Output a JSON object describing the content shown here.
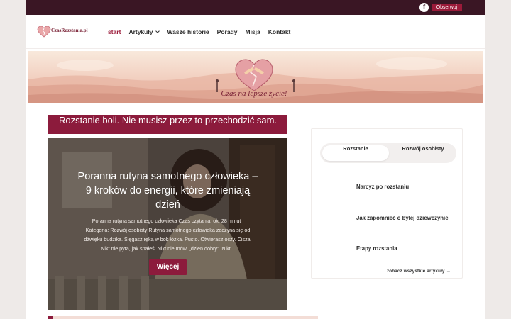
{
  "topbar": {
    "facebook_icon": "facebook-icon",
    "follow_label": "Obserwuj",
    "bg_color": "#3a1624",
    "accent": "#9b1b3a"
  },
  "header": {
    "logo_text": "CzasRozstania.pl",
    "nav": [
      {
        "label": "start",
        "active": true
      },
      {
        "label": "Artykuły",
        "dropdown": true
      },
      {
        "label": "Wasze historie"
      },
      {
        "label": "Porady"
      },
      {
        "label": "Misja"
      },
      {
        "label": "Kontakt"
      }
    ]
  },
  "banner": {
    "tagline": "Czas na lepsze życie!",
    "icon": "broken-heart-icon"
  },
  "main": {
    "headline": "Rozstanie boli. Nie musisz przez to przechodzić sam.",
    "featured": {
      "title": "Poranna rutyna samotnego człowieka – 9 kroków do energii, które zmieniają dzień",
      "excerpt": "Poranna rutyna samotnego człowieka Czas czytania: ok. 28 minut | Kategoria: Rozwój osobisty Rutyna samotnego człowieka zaczyna się od dźwięku budzika. Sięgasz ręką w bok łóżka. Pusto. Otwierasz oczy. Cisza. Nikt nie pyta, jak spałeś. Nikt nie mówi „dzień dobry”. Nikt...",
      "button_label": "Więcej"
    }
  },
  "sidebar": {
    "tabs": [
      {
        "label": "Rozstanie",
        "active": true
      },
      {
        "label": "Rozwój osobisty"
      }
    ],
    "articles": [
      {
        "title": "Narcyz po rozstaniu"
      },
      {
        "title": "Jak zapomnieć o byłej dziewczynie"
      },
      {
        "title": "Etapy rozstania"
      }
    ],
    "all_link": "zobacz wszystkie artykuły →"
  },
  "colors": {
    "brand": "#8c1b3c",
    "text": "#2d2d2d"
  }
}
